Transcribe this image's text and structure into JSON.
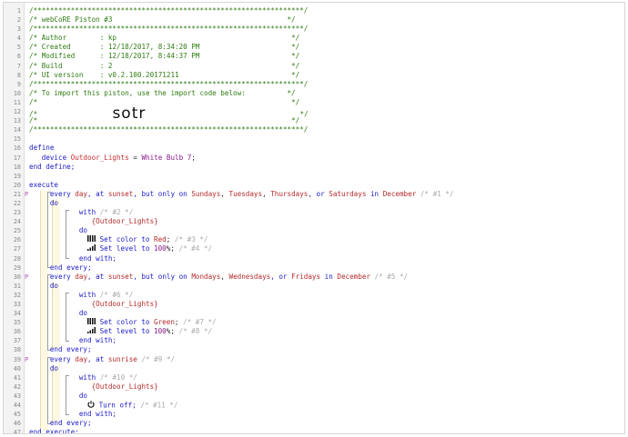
{
  "editor": {
    "lines": [
      {
        "n": "1",
        "segs": [
          {
            "t": "/*****************************************************************/",
            "c": "comment"
          }
        ]
      },
      {
        "n": "2",
        "segs": [
          {
            "t": "/* webCoRE Piston #3                                          */",
            "c": "comment"
          }
        ]
      },
      {
        "n": "3",
        "segs": [
          {
            "t": "/*****************************************************************/",
            "c": "comment"
          }
        ]
      },
      {
        "n": "4",
        "segs": [
          {
            "t": "/* Author        : kp                                          */",
            "c": "comment"
          }
        ]
      },
      {
        "n": "5",
        "segs": [
          {
            "t": "/* Created       : 12/18/2017, 8:34:20 PM                      */",
            "c": "comment"
          }
        ]
      },
      {
        "n": "6",
        "segs": [
          {
            "t": "/* Modified      : 12/18/2017, 8:44:37 PM                      */",
            "c": "comment"
          }
        ]
      },
      {
        "n": "7",
        "segs": [
          {
            "t": "/* Build         : 2                                           */",
            "c": "comment"
          }
        ]
      },
      {
        "n": "8",
        "segs": [
          {
            "t": "/* UI version    : v0.2.100.20171211                           */",
            "c": "comment"
          }
        ]
      },
      {
        "n": "9",
        "segs": [
          {
            "t": "/*****************************************************************/",
            "c": "comment"
          }
        ]
      },
      {
        "n": "10",
        "segs": [
          {
            "t": "/* To import this piston, use the import code below:          */",
            "c": "comment"
          }
        ]
      },
      {
        "n": "11",
        "segs": [
          {
            "t": "/*                                                             */",
            "c": "comment"
          }
        ]
      },
      {
        "n": "12",
        "segs": [
          {
            "t": "/*                  ",
            "c": "comment"
          },
          {
            "t": "sotr",
            "c": "sotr"
          },
          {
            "t": "                                     */",
            "c": "comment"
          }
        ]
      },
      {
        "n": "13",
        "segs": [
          {
            "t": "/*                                                             */",
            "c": "comment"
          }
        ]
      },
      {
        "n": "14",
        "segs": [
          {
            "t": "/*****************************************************************/",
            "c": "comment"
          }
        ]
      },
      {
        "n": "15",
        "segs": []
      },
      {
        "n": "16",
        "segs": [
          {
            "t": "define",
            "c": "kw"
          }
        ]
      },
      {
        "n": "17",
        "segs": [
          {
            "t": "   device ",
            "c": "kw"
          },
          {
            "t": "Outdoor_Lights",
            "c": "dev"
          },
          {
            "t": " = ",
            "c": ""
          },
          {
            "t": "White Bulb 7",
            "c": "num"
          },
          {
            "t": ";",
            "c": ""
          }
        ]
      },
      {
        "n": "18",
        "segs": [
          {
            "t": "end define;",
            "c": "kw"
          }
        ]
      },
      {
        "n": "19",
        "segs": []
      },
      {
        "n": "20",
        "segs": [
          {
            "t": "execute",
            "c": "kw"
          }
        ]
      },
      {
        "n": "21",
        "m": "P",
        "segs": [
          {
            "t": "     every ",
            "c": "kw"
          },
          {
            "t": "day",
            "c": "val"
          },
          {
            "t": ", at ",
            "c": "kw"
          },
          {
            "t": "sunset",
            "c": "val"
          },
          {
            "t": ", but only on ",
            "c": "kw"
          },
          {
            "t": "Sundays",
            "c": "val"
          },
          {
            "t": ", ",
            "c": ""
          },
          {
            "t": "Tuesdays",
            "c": "val"
          },
          {
            "t": ", ",
            "c": ""
          },
          {
            "t": "Thursdays",
            "c": "val"
          },
          {
            "t": ", or ",
            "c": "kw"
          },
          {
            "t": "Saturdays",
            "c": "val"
          },
          {
            "t": " in ",
            "c": "kw"
          },
          {
            "t": "December",
            "c": "val"
          },
          {
            "t": " /* #1 */",
            "c": "dim"
          }
        ]
      },
      {
        "n": "22",
        "segs": [
          {
            "t": "     do",
            "c": "kw"
          }
        ]
      },
      {
        "n": "23",
        "segs": [
          {
            "t": "            with ",
            "c": "kw"
          },
          {
            "t": "/* #2 */",
            "c": "dim"
          }
        ]
      },
      {
        "n": "24",
        "segs": [
          {
            "t": "               {Outdoor_Lights}",
            "c": "val"
          }
        ]
      },
      {
        "n": "25",
        "segs": [
          {
            "t": "            do",
            "c": "kw"
          }
        ]
      },
      {
        "n": "26",
        "icon": "color",
        "segs": [
          {
            "t": "                Set color to ",
            "c": "kw"
          },
          {
            "t": "Red",
            "c": "val"
          },
          {
            "t": "; ",
            "c": ""
          },
          {
            "t": "/* #3 */",
            "c": "dim"
          }
        ]
      },
      {
        "n": "27",
        "icon": "level",
        "segs": [
          {
            "t": "                Set level to ",
            "c": "kw"
          },
          {
            "t": "100",
            "c": "num"
          },
          {
            "t": "%; ",
            "c": ""
          },
          {
            "t": "/* #4 */",
            "c": "dim"
          }
        ]
      },
      {
        "n": "28",
        "segs": [
          {
            "t": "            end with;",
            "c": "kw"
          }
        ]
      },
      {
        "n": "29",
        "segs": [
          {
            "t": "     end every;",
            "c": "kw"
          }
        ]
      },
      {
        "n": "30",
        "m": "P",
        "segs": [
          {
            "t": "     every ",
            "c": "kw"
          },
          {
            "t": "day",
            "c": "val"
          },
          {
            "t": ", at ",
            "c": "kw"
          },
          {
            "t": "sunset",
            "c": "val"
          },
          {
            "t": ", but only on ",
            "c": "kw"
          },
          {
            "t": "Mondays",
            "c": "val"
          },
          {
            "t": ", ",
            "c": ""
          },
          {
            "t": "Wednesdays",
            "c": "val"
          },
          {
            "t": ", or ",
            "c": "kw"
          },
          {
            "t": "Fridays",
            "c": "val"
          },
          {
            "t": " in ",
            "c": "kw"
          },
          {
            "t": "December",
            "c": "val"
          },
          {
            "t": " /* #5 */",
            "c": "dim"
          }
        ]
      },
      {
        "n": "31",
        "segs": [
          {
            "t": "     do",
            "c": "kw"
          }
        ]
      },
      {
        "n": "32",
        "segs": [
          {
            "t": "            with ",
            "c": "kw"
          },
          {
            "t": "/* #6 */",
            "c": "dim"
          }
        ]
      },
      {
        "n": "33",
        "segs": [
          {
            "t": "               {Outdoor_Lights}",
            "c": "val"
          }
        ]
      },
      {
        "n": "34",
        "segs": [
          {
            "t": "            do",
            "c": "kw"
          }
        ]
      },
      {
        "n": "35",
        "icon": "color",
        "segs": [
          {
            "t": "                Set color to ",
            "c": "kw"
          },
          {
            "t": "Green",
            "c": "val"
          },
          {
            "t": "; ",
            "c": ""
          },
          {
            "t": "/* #7 */",
            "c": "dim"
          }
        ]
      },
      {
        "n": "36",
        "icon": "level",
        "segs": [
          {
            "t": "                Set level to ",
            "c": "kw"
          },
          {
            "t": "100",
            "c": "num"
          },
          {
            "t": "%; ",
            "c": ""
          },
          {
            "t": "/* #8 */",
            "c": "dim"
          }
        ]
      },
      {
        "n": "37",
        "segs": [
          {
            "t": "            end with;",
            "c": "kw"
          }
        ]
      },
      {
        "n": "38",
        "segs": [
          {
            "t": "     end every;",
            "c": "kw"
          }
        ]
      },
      {
        "n": "39",
        "m": "P",
        "segs": [
          {
            "t": "     every ",
            "c": "kw"
          },
          {
            "t": "day",
            "c": "val"
          },
          {
            "t": ", at ",
            "c": "kw"
          },
          {
            "t": "sunrise",
            "c": "val"
          },
          {
            "t": " /* #9 */",
            "c": "dim"
          }
        ]
      },
      {
        "n": "40",
        "segs": [
          {
            "t": "     do",
            "c": "kw"
          }
        ]
      },
      {
        "n": "41",
        "segs": [
          {
            "t": "            with ",
            "c": "kw"
          },
          {
            "t": "/* #10 */",
            "c": "dim"
          }
        ]
      },
      {
        "n": "42",
        "segs": [
          {
            "t": "               {Outdoor_Lights}",
            "c": "val"
          }
        ]
      },
      {
        "n": "43",
        "segs": [
          {
            "t": "            do",
            "c": "kw"
          }
        ]
      },
      {
        "n": "44",
        "icon": "power",
        "segs": [
          {
            "t": "                Turn off; ",
            "c": "kw"
          },
          {
            "t": "/* #11 */",
            "c": "dim"
          }
        ]
      },
      {
        "n": "45",
        "segs": [
          {
            "t": "            end with;",
            "c": "kw"
          }
        ]
      },
      {
        "n": "46",
        "segs": [
          {
            "t": "     end every;",
            "c": "kw"
          }
        ]
      },
      {
        "n": "47",
        "segs": [
          {
            "t": "end execute;",
            "c": "kw"
          }
        ]
      }
    ]
  },
  "colors": {
    "comment": "#2f7a12",
    "keyword": "#1b1bc9",
    "value": "#c43030",
    "number": "#8a1a8a",
    "dim": "#aaaaaa",
    "block_bg": "#fdf8e4"
  },
  "icons": {
    "color": "color-swatch-icon",
    "level": "level-bars-icon",
    "power": "power-icon",
    "marker": "piston-marker-icon"
  }
}
